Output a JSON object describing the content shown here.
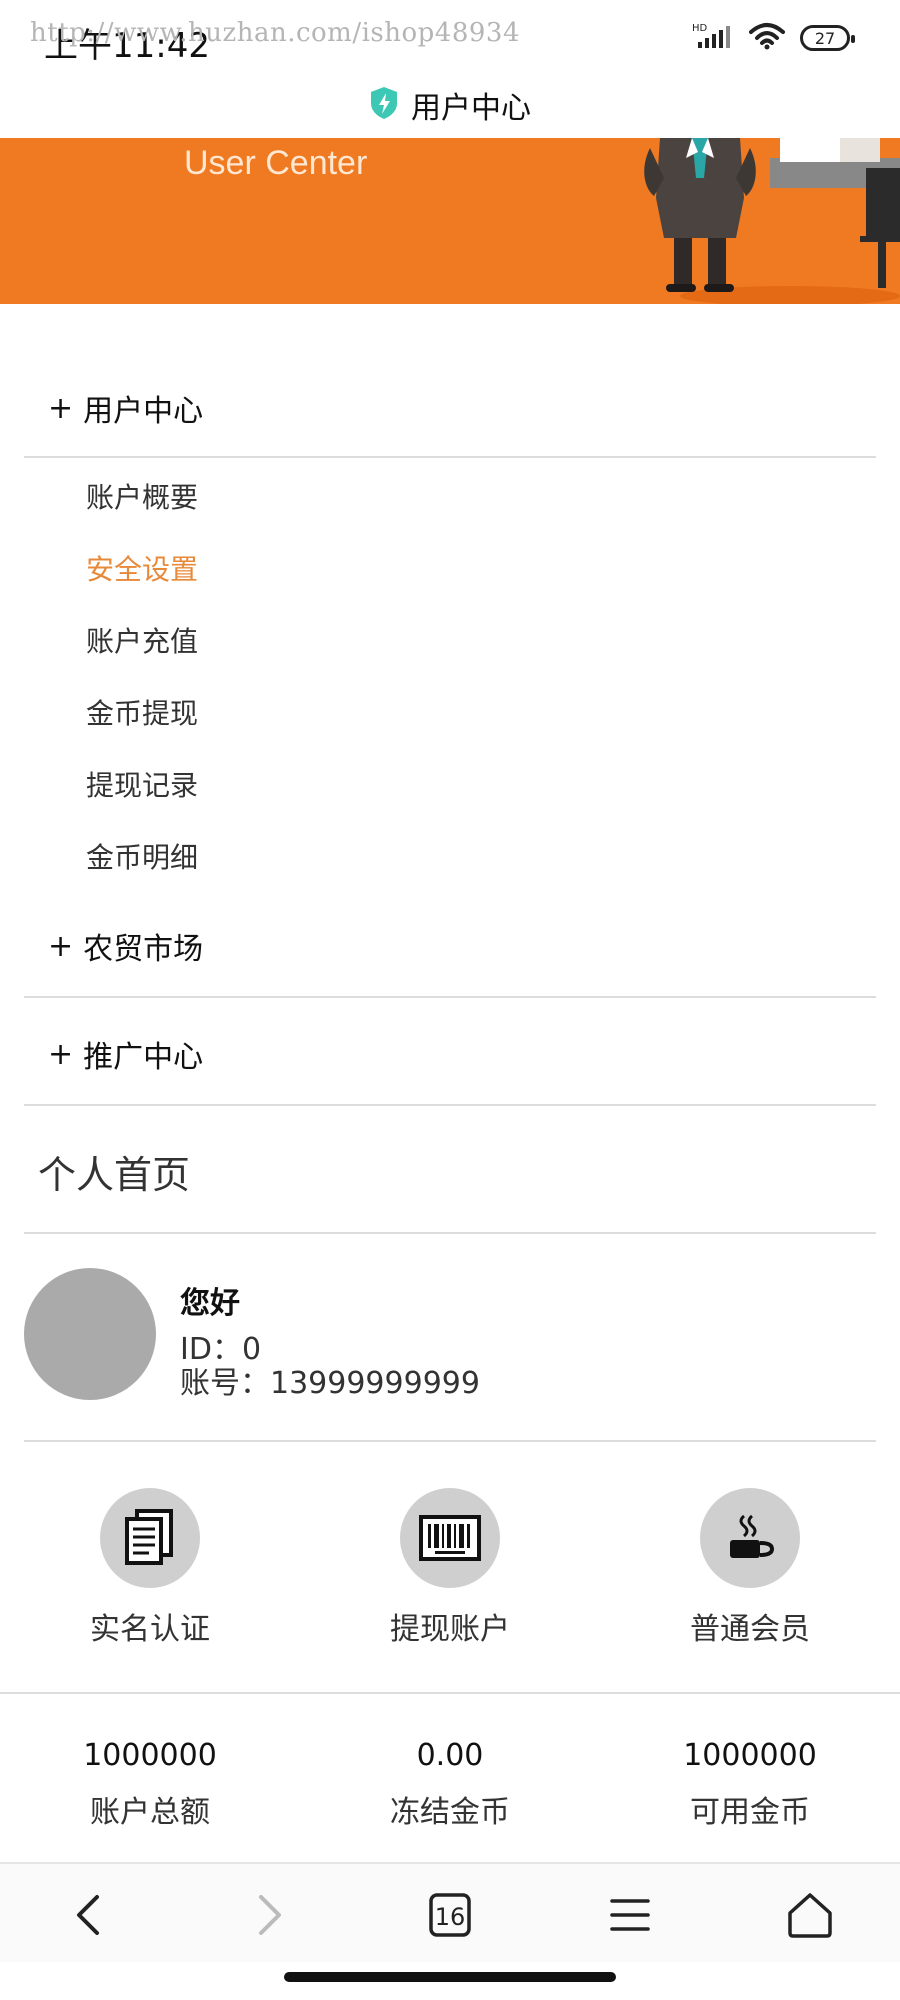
{
  "status_bar": {
    "time": "上午11:42",
    "watermark": "http://www.huzhan.com/ishop48934",
    "network": "HD",
    "battery": "27"
  },
  "header": {
    "title": "用户中心"
  },
  "banner": {
    "subtitle": "User Center"
  },
  "menu": [
    {
      "label": "用户中心",
      "expanded": true,
      "items": [
        {
          "label": "账户概要",
          "active": false
        },
        {
          "label": "安全设置",
          "active": true
        },
        {
          "label": "账户充值",
          "active": false
        },
        {
          "label": "金币提现",
          "active": false
        },
        {
          "label": "提现记录",
          "active": false
        },
        {
          "label": "金币明细",
          "active": false
        }
      ]
    },
    {
      "label": "农贸市场",
      "expanded": false
    },
    {
      "label": "推广中心",
      "expanded": false
    }
  ],
  "menu_prefix": "+",
  "section_title": "个人首页",
  "profile": {
    "greeting": "您好",
    "id_line": "ID：0",
    "account_line": "账号：13999999999"
  },
  "features": [
    {
      "label": "实名认证",
      "icon": "documents-icon"
    },
    {
      "label": "提现账户",
      "icon": "barcode-icon"
    },
    {
      "label": "普通会员",
      "icon": "coffee-cup-icon"
    }
  ],
  "stats": [
    {
      "value": "1000000",
      "label": "账户总额"
    },
    {
      "value": "0.00",
      "label": "冻结金币"
    },
    {
      "value": "1000000",
      "label": "可用金币"
    }
  ],
  "bottom_nav": {
    "tab_count": "16",
    "items": [
      "back-icon",
      "forward-icon",
      "tabs-icon",
      "menu-icon",
      "home-icon"
    ]
  },
  "colors": {
    "banner": "#f07a22",
    "active_menu": "#e8893a",
    "shield": "#3cc8b4",
    "avatar": "#aaaaaa"
  }
}
